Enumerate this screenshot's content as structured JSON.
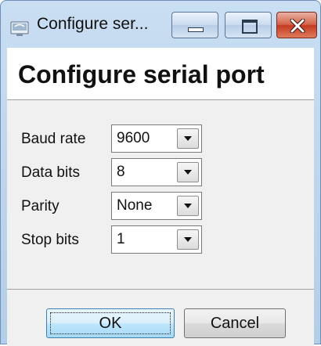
{
  "window": {
    "title": "Configure ser...",
    "app_icon": "serial-port-app-icon",
    "caption_buttons": [
      "minimize-icon",
      "maximize-icon",
      "close-icon"
    ]
  },
  "header": {
    "title": "Configure serial port"
  },
  "form": {
    "fields": [
      {
        "label": "Baud rate",
        "value": "9600"
      },
      {
        "label": "Data bits",
        "value": "8"
      },
      {
        "label": "Parity",
        "value": "None"
      },
      {
        "label": "Stop bits",
        "value": "1"
      }
    ]
  },
  "buttons": {
    "ok": "OK",
    "cancel": "Cancel"
  },
  "colors": {
    "title_bar": "#c9def2",
    "close_button": "#c43b22",
    "ok_button_border": "#3c7fb1"
  }
}
